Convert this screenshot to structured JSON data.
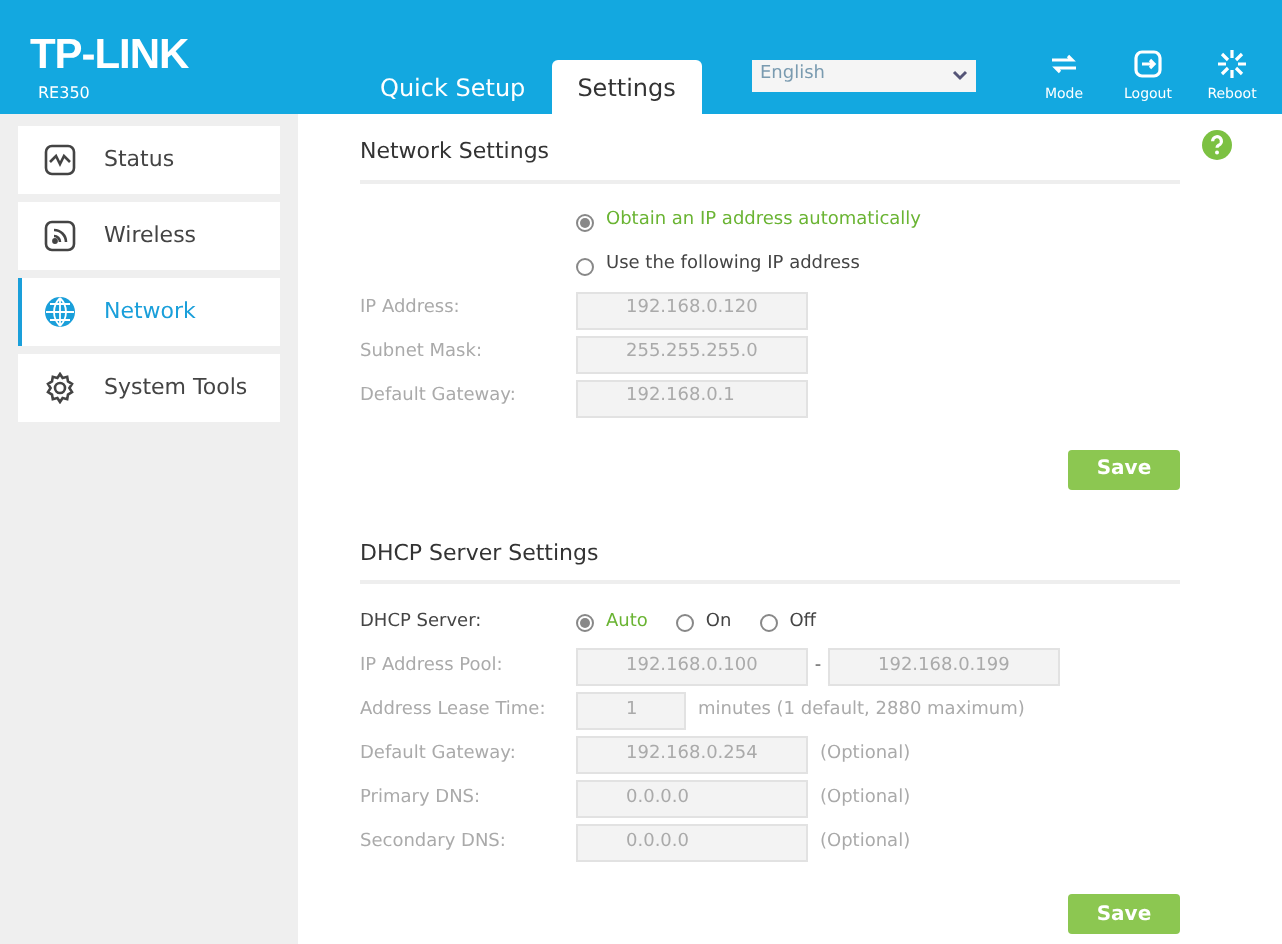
{
  "header": {
    "logo": "TP-LINK",
    "model": "RE350",
    "tabs": [
      {
        "label": "Quick Setup",
        "selected": false
      },
      {
        "label": "Settings",
        "selected": true
      }
    ],
    "language": "English",
    "actions": [
      {
        "kind": "mode",
        "label": "Mode"
      },
      {
        "kind": "logout",
        "label": "Logout"
      },
      {
        "kind": "reboot",
        "label": "Reboot"
      }
    ]
  },
  "sidebar": {
    "items": [
      {
        "kind": "status",
        "label": "Status",
        "selected": false
      },
      {
        "kind": "wireless",
        "label": "Wireless",
        "selected": false
      },
      {
        "kind": "network",
        "label": "Network",
        "selected": true
      },
      {
        "kind": "tools",
        "label": "System Tools",
        "selected": false
      }
    ]
  },
  "sections": [
    {
      "title": "Network Settings",
      "rows": [
        {
          "kind": "radio",
          "options": [
            {
              "label": "Obtain an IP address automatically",
              "selected": true
            }
          ]
        },
        {
          "kind": "radio",
          "options": [
            {
              "label": "Use the following IP address",
              "selected": false
            }
          ]
        },
        {
          "kind": "field",
          "label": "IP Address:",
          "value": "192.168.0.120",
          "disabled": true
        },
        {
          "kind": "field",
          "label": "Subnet Mask:",
          "value": "255.255.255.0",
          "disabled": true
        },
        {
          "kind": "field",
          "label": "Default Gateway:",
          "value": "192.168.0.1",
          "disabled": true
        }
      ],
      "button": "Save"
    },
    {
      "title": "DHCP Server Settings",
      "rows": [
        {
          "kind": "radio",
          "label": "DHCP Server:",
          "disabled": false,
          "options": [
            {
              "label": "Auto",
              "selected": true
            },
            {
              "label": "On",
              "selected": false
            },
            {
              "label": "Off",
              "selected": false
            }
          ]
        },
        {
          "kind": "range",
          "label": "IP Address Pool:",
          "value": "192.168.0.100",
          "separator": "-",
          "value_2": "192.168.0.199",
          "disabled": true
        },
        {
          "kind": "short",
          "label": "Address Lease Time:",
          "value": "1",
          "note": "minutes (1 default, 2880 maximum)",
          "disabled": true
        },
        {
          "kind": "field",
          "label": "Default Gateway:",
          "value": "192.168.0.254",
          "note": "(Optional)",
          "disabled": true
        },
        {
          "kind": "field",
          "label": "Primary DNS:",
          "value": "0.0.0.0",
          "note": "(Optional)",
          "disabled": true
        },
        {
          "kind": "field",
          "label": "Secondary DNS:",
          "value": "0.0.0.0",
          "note": "(Optional)",
          "disabled": true
        }
      ],
      "button": "Save"
    }
  ]
}
